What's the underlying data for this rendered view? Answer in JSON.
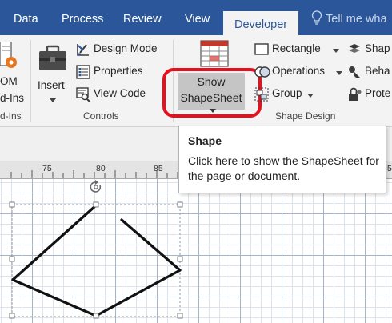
{
  "tabs": [
    {
      "label": "Data",
      "active": false
    },
    {
      "label": "Process",
      "active": false
    },
    {
      "label": "Review",
      "active": false
    },
    {
      "label": "View",
      "active": false
    },
    {
      "label": "Developer",
      "active": true
    }
  ],
  "tell_me": "Tell me wha",
  "ribbon": {
    "com_addins": {
      "label_top": "OM",
      "label_bottom": "d-Ins"
    },
    "controls": {
      "insert_label": "Insert",
      "design_mode_label": "Design Mode",
      "properties_label": "Properties",
      "view_code_label": "View Code",
      "group_label": "Controls",
      "left_group_label": "d-Ins"
    },
    "shape_design": {
      "show_shapesheet_line1": "Show",
      "show_shapesheet_line2": "ShapeSheet",
      "rectangle_label": "Rectangle",
      "operations_label": "Operations",
      "group_label": "Group",
      "group_title": "Shape Design",
      "shape_name_label": "Shap",
      "behavior_label": "Beha",
      "protection_label": "Prote"
    }
  },
  "ruler": {
    "ticks": [
      "75",
      "80",
      "85",
      "5"
    ]
  },
  "tooltip": {
    "title": "Shape",
    "body": "Click here to show the ShapeSheet for the page or document."
  },
  "colors": {
    "ribbon_tab_bar": "#2b579a",
    "ribbon_body": "#f3f3f3",
    "highlight_ring": "#e8101c",
    "button_pressed": "#c5c5c5"
  }
}
